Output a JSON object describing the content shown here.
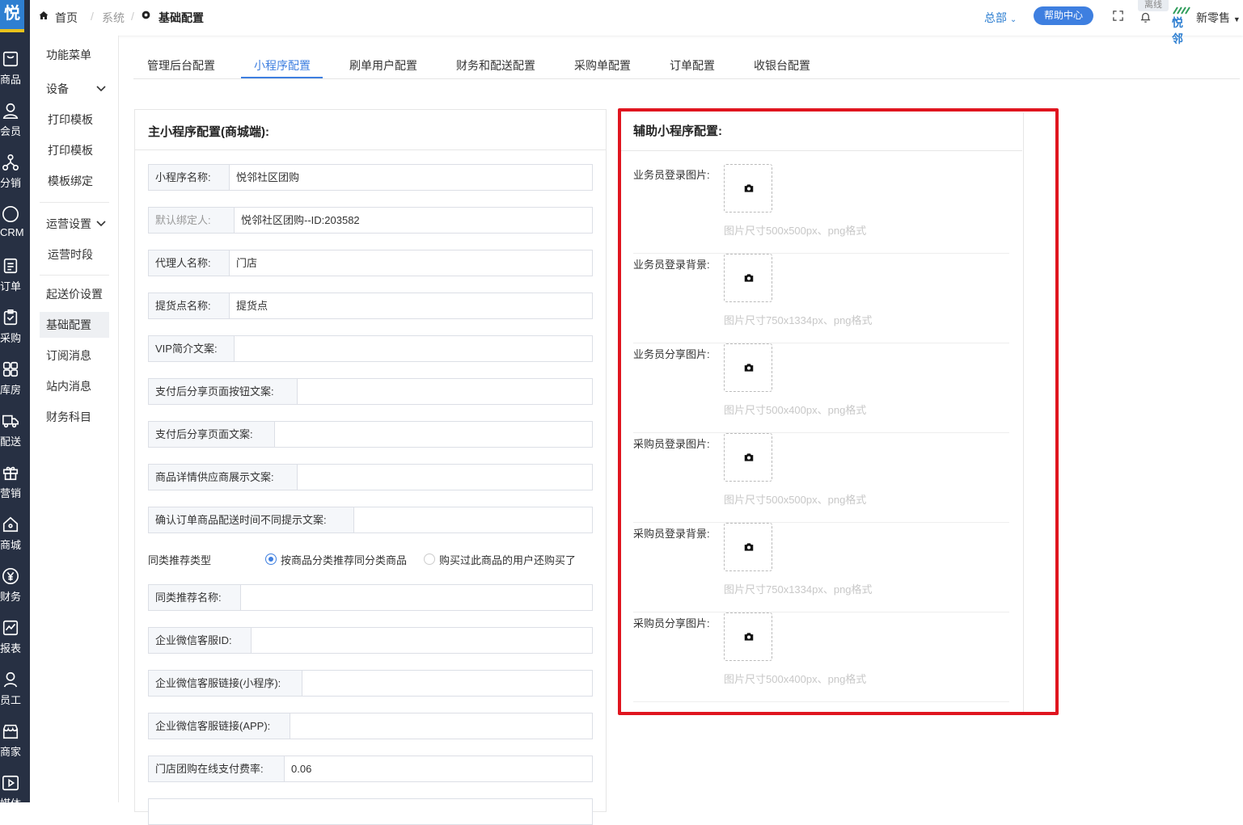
{
  "rail": {
    "logo": "悦",
    "items": [
      {
        "label": "商品",
        "icon": "goods-icon"
      },
      {
        "label": "会员",
        "icon": "member-icon"
      },
      {
        "label": "分销",
        "icon": "distribution-icon"
      },
      {
        "label": "CRM",
        "icon": "crm-icon"
      },
      {
        "label": "订单",
        "icon": "order-icon"
      },
      {
        "label": "采购",
        "icon": "purchase-icon"
      },
      {
        "label": "库房",
        "icon": "warehouse-icon"
      },
      {
        "label": "配送",
        "icon": "delivery-icon"
      },
      {
        "label": "营销",
        "icon": "marketing-icon"
      },
      {
        "label": "商城",
        "icon": "mall-icon"
      },
      {
        "label": "财务",
        "icon": "finance-icon"
      },
      {
        "label": "报表",
        "icon": "report-icon"
      },
      {
        "label": "员工",
        "icon": "staff-icon"
      },
      {
        "label": "商家",
        "icon": "merchant-icon"
      },
      {
        "label": "媒体",
        "icon": "media-icon"
      }
    ]
  },
  "submenu": {
    "items": [
      "功能菜单",
      "设备",
      "打印模板",
      "打印模板",
      "模板绑定",
      "运营设置",
      "运营时段",
      "起送价设置",
      "基础配置",
      "订阅消息",
      "站内消息",
      "财务科目"
    ]
  },
  "topbar": {
    "home": "首页",
    "crumb_system": "系统",
    "crumb_current": "基础配置",
    "hq": "总部",
    "help": "帮助中心",
    "offline": "离线",
    "brand": "悦邻",
    "store": "新零售"
  },
  "tabs": [
    "管理后台配置",
    "小程序配置",
    "刷单用户配置",
    "财务和配送配置",
    "采购单配置",
    "订单配置",
    "收银台配置"
  ],
  "left": {
    "title": "主小程序配置(商城端):",
    "fields": [
      {
        "label": "小程序名称:",
        "value": "悦邻社区团购"
      },
      {
        "label": "默认绑定人:",
        "value": "悦邻社区团购--ID:203582"
      },
      {
        "label": "代理人名称:",
        "value": "门店"
      },
      {
        "label": "提货点名称:",
        "value": "提货点"
      },
      {
        "label": "VIP简介文案:",
        "value": ""
      },
      {
        "label": "支付后分享页面按钮文案:",
        "value": ""
      },
      {
        "label": "支付后分享页面文案:",
        "value": ""
      },
      {
        "label": "商品详情供应商展示文案:",
        "value": ""
      },
      {
        "label": "确认订单商品配送时间不同提示文案:",
        "value": ""
      }
    ],
    "recommend_type_label": "同类推荐类型",
    "radio_option_1": "按商品分类推荐同分类商品",
    "radio_option_2": "购买过此商品的用户还购买了",
    "fields2": [
      {
        "label": "同类推荐名称:",
        "value": ""
      },
      {
        "label": "企业微信客服ID:",
        "value": ""
      },
      {
        "label": "企业微信客服链接(小程序):",
        "value": ""
      },
      {
        "label": "企业微信客服链接(APP):",
        "value": ""
      },
      {
        "label": "门店团购在线支付费率:",
        "value": "0.06"
      }
    ]
  },
  "right": {
    "title": "辅助小程序配置:",
    "uploads": [
      {
        "label": "业务员登录图片:",
        "hint": "图片尺寸500x500px、png格式"
      },
      {
        "label": "业务员登录背景:",
        "hint": "图片尺寸750x1334px、png格式"
      },
      {
        "label": "业务员分享图片:",
        "hint": "图片尺寸500x400px、png格式"
      },
      {
        "label": "采购员登录图片:",
        "hint": "图片尺寸500x500px、png格式"
      },
      {
        "label": "采购员登录背景:",
        "hint": "图片尺寸750x1334px、png格式"
      },
      {
        "label": "采购员分享图片:",
        "hint": "图片尺寸500x400px、png格式"
      }
    ]
  },
  "colors": {
    "accent": "#3e7fe0",
    "rail": "#273043",
    "highlight": "#e0151f"
  }
}
